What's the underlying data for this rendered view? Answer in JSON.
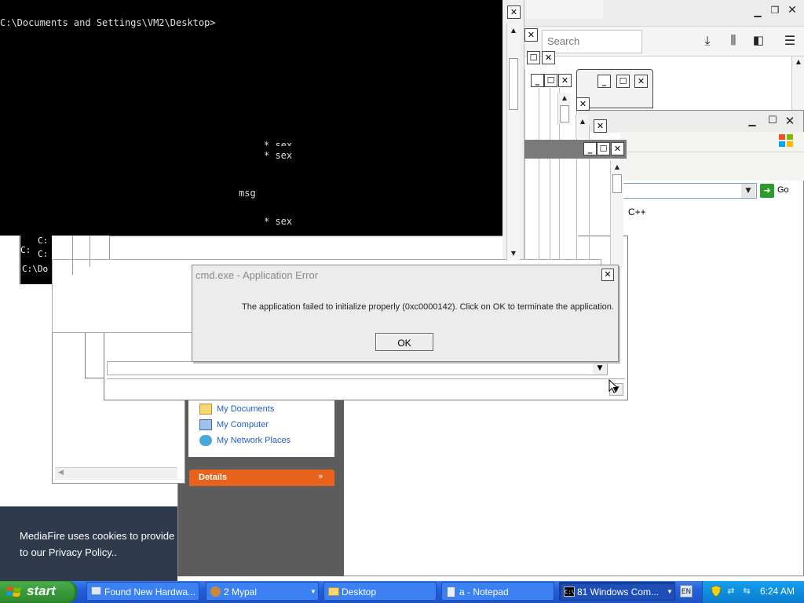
{
  "console": {
    "prompt": "C:\\Documents and Settings\\VM2\\Desktop>",
    "line1": "* sex",
    "line2": "* sex",
    "line3": "msg",
    "line4": "* sex",
    "small_prompt_1": "C:",
    "small_prompt_2": "C:",
    "small_prompt_3": "C:\\Do"
  },
  "browser": {
    "search_placeholder": "Search",
    "go_label": "Go",
    "text_fragment": "C++"
  },
  "dialog": {
    "title": "cmd.exe - Application Error",
    "message": "The application failed to initialize properly (0xc0000142). Click on OK to terminate the application.",
    "ok_label": "OK"
  },
  "places": {
    "items": [
      {
        "label": "My Documents"
      },
      {
        "label": "My Computer"
      },
      {
        "label": "My Network Places"
      }
    ],
    "details_label": "Details"
  },
  "cookie_banner": {
    "line1": "MediaFire uses cookies to provide",
    "line2": "to our Privacy Policy.."
  },
  "taskbar": {
    "start_label": "start",
    "tasks": [
      {
        "label": "Found New Hardwa..."
      },
      {
        "label": "2 Mypal"
      },
      {
        "label": "Desktop"
      },
      {
        "label": "a - Notepad"
      },
      {
        "label": "81 Windows Com..."
      }
    ],
    "clock": "6:24 AM",
    "colors": {
      "taskbar_blue": "#245edb",
      "start_green": "#3a9a3a",
      "details_orange": "#e8621c"
    }
  }
}
